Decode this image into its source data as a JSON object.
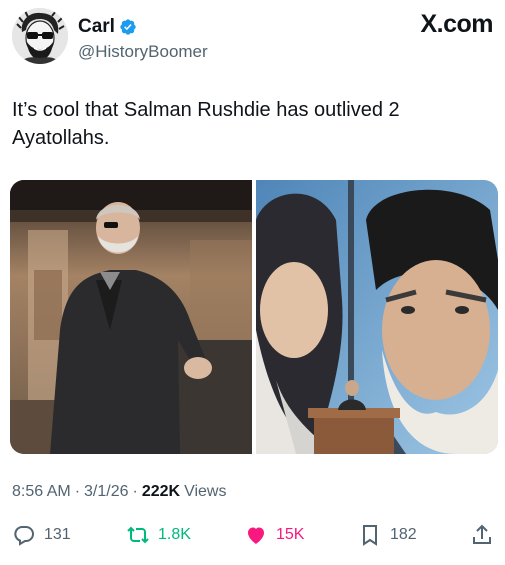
{
  "author": {
    "name": "Carl",
    "handle": "@HistoryBoomer",
    "verified": true
  },
  "brand": "X.com",
  "tweet": {
    "text": "It’s cool that Salman Rushdie has outlived 2 Ayatollahs."
  },
  "meta": {
    "time": "8:56 AM",
    "date": "3/1/26",
    "views_count": "222K",
    "views_label": "Views",
    "separator": "·"
  },
  "actions": {
    "replies": "131",
    "reposts": "1.8K",
    "likes": "15K",
    "bookmarks": "182"
  },
  "colors": {
    "verified": "#1d9bf0",
    "repost_active": "#00ba7c",
    "like_active": "#f91880",
    "secondary_text": "#536471"
  },
  "icons": [
    "verified-badge-icon",
    "reply-icon",
    "repost-icon",
    "like-icon",
    "bookmark-icon",
    "share-icon"
  ]
}
